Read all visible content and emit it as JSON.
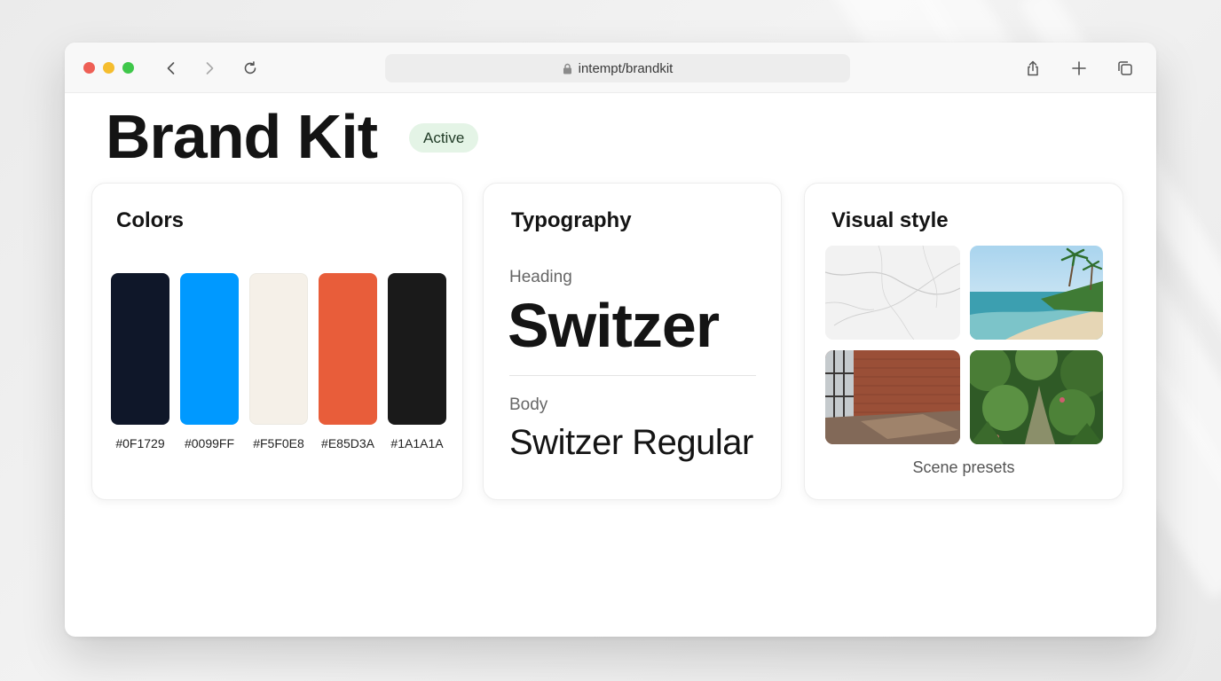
{
  "browser": {
    "address": "intempt/brandkit"
  },
  "page": {
    "title": "Brand Kit",
    "status": "Active"
  },
  "colors": {
    "title": "Colors",
    "swatches": [
      {
        "hex": "#0F1729",
        "color": "#0F1729"
      },
      {
        "hex": "#0099FF",
        "color": "#0099FF"
      },
      {
        "hex": "#F5F0E8",
        "color": "#F5F0E8"
      },
      {
        "hex": "#E85D3A",
        "color": "#E85D3A"
      },
      {
        "hex": "#1A1A1A",
        "color": "#1A1A1A"
      }
    ]
  },
  "typography": {
    "title": "Typography",
    "heading_label": "Heading",
    "heading_sample": "Switzer",
    "body_label": "Body",
    "body_sample": "Switzer Regular"
  },
  "visual_style": {
    "title": "Visual style",
    "caption": "Scene presets",
    "scenes": [
      "marble-scene",
      "beach-scene",
      "brick-room-scene",
      "jungle-scene"
    ]
  },
  "theme": {
    "badge_bg": "#E4F4E6",
    "traffic_red": "#EE5F55",
    "traffic_yellow": "#F5BD2E",
    "traffic_green": "#3FC74A"
  }
}
